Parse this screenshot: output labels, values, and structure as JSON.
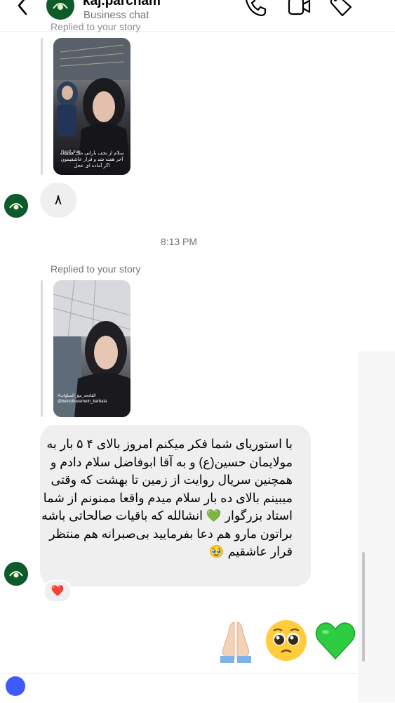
{
  "header": {
    "username": "kaj.parcham",
    "subtitle": "Business chat"
  },
  "messages": {
    "replied_top": "Replied to your story",
    "story1_caption": "سلام از نجف بارانی مثل همیشه آخر هفته شد و قرار عاشقیمون اگر آماده ای عجل",
    "story1_tag": "Najaf, Iraq",
    "small_reply": "٨",
    "timestamp": "8:13 PM",
    "replied_label": "Replied to your story",
    "story2_caption": "#الفاتحه_مع_الصلوات @beinolharamein_karbala",
    "main_message": "با استوریای شما فکر میکنم امروز بالای ۴ ۵ بار به مولایمان حسین(ع) و به آقا ابوفاضل سلام دادم و همچنین سریال روایت از زمین تا بهشت که وقتی میبینم بالای ده بار سلام میدم واقعا ممنونم از شما استاد بزرگوار 💚 انشالله که باقیات صالحاتی باشه براتون مارو هم دعا بفرمایید بی‌صبرانه هم منتظر قرار عاشقیم 🥹",
    "reaction": "❤️"
  },
  "colors": {
    "bubble": "#efefef",
    "muted_text": "#737373",
    "brand_green": "#0d5a2a"
  },
  "icons": {
    "back": "chevron-left-icon",
    "call": "phone-icon",
    "video": "video-camera-icon",
    "tag": "tag-icon"
  }
}
